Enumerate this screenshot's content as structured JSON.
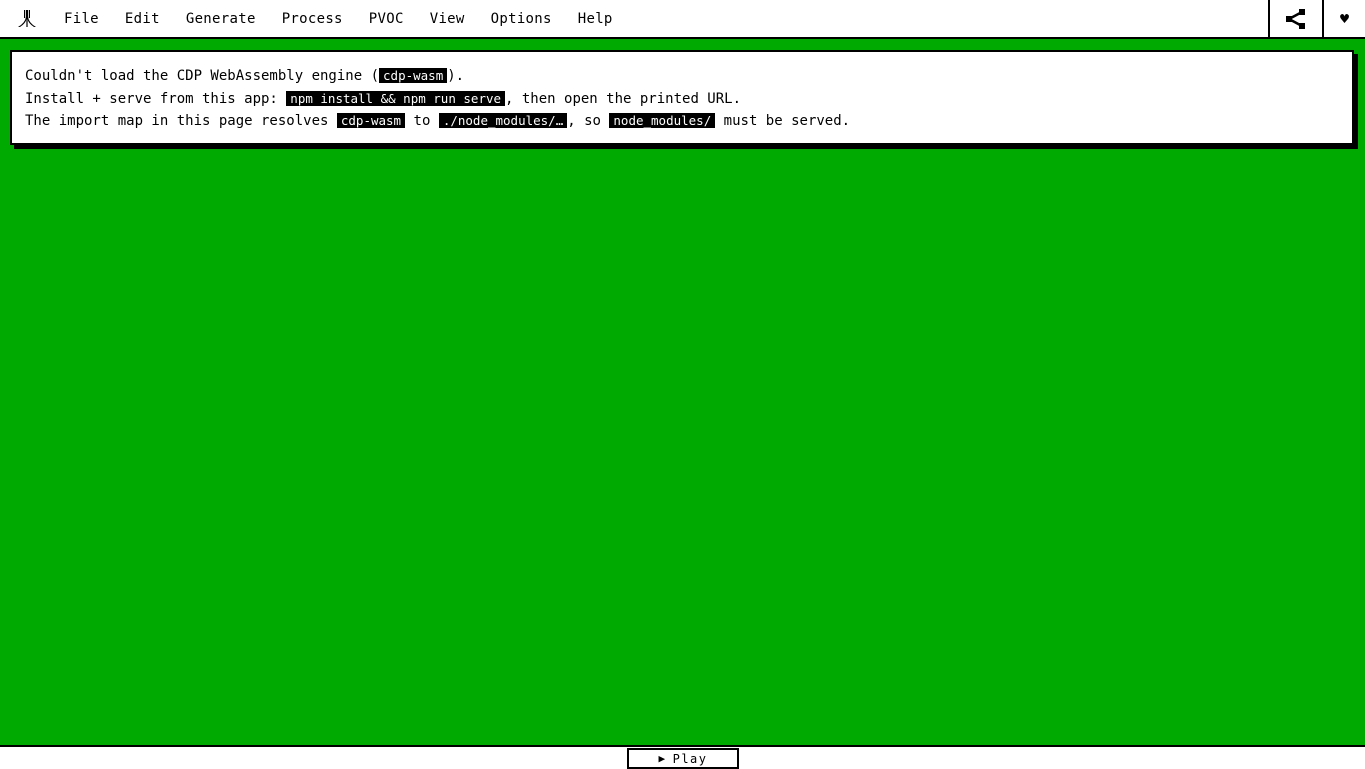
{
  "menubar": {
    "logo": "atari-logo-icon",
    "items": [
      "File",
      "Edit",
      "Generate",
      "Process",
      "PVOC",
      "View",
      "Options",
      "Help"
    ],
    "share_icon": "share-icon",
    "heart_label": "♥"
  },
  "error": {
    "line1": {
      "pre": "Couldn't load the CDP WebAssembly engine (",
      "code": "cdp-wasm",
      "post": ")."
    },
    "line2": {
      "pre": "Install + serve from this app: ",
      "code": "npm install && npm run serve",
      "post": ", then open the printed URL."
    },
    "line3": {
      "pre": "The import map in this page resolves ",
      "code1": "cdp-wasm",
      "mid1": " to ",
      "code2": "./node_modules/…",
      "mid2": ", so ",
      "code3": "node_modules/",
      "post": " must be served."
    }
  },
  "bottom": {
    "play_glyph": "▶",
    "play_label": "Play"
  },
  "colors": {
    "desktop": "#00aa00",
    "foreground": "#000000",
    "background": "#ffffff"
  }
}
